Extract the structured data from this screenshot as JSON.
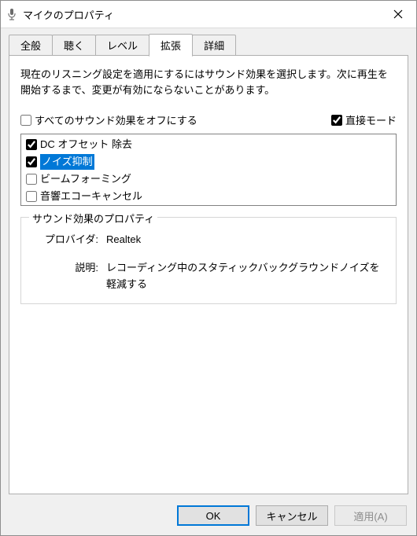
{
  "window": {
    "title": "マイクのプロパティ"
  },
  "tabs": {
    "general": "全般",
    "listen": "聴く",
    "levels": "レベル",
    "enhance": "拡張",
    "advanced": "詳細"
  },
  "intro": "現在のリスニング設定を適用にするにはサウンド効果を選択します。次に再生を開始するまで、変更が有効にならないことがあります。",
  "row_checks": {
    "disable_all": {
      "label": "すべてのサウンド効果をオフにする",
      "checked": false
    },
    "direct_mode": {
      "label": "直接モード",
      "checked": true
    }
  },
  "effects": [
    {
      "label": "DC オフセット 除去",
      "checked": true,
      "selected": false
    },
    {
      "label": "ノイズ抑制",
      "checked": true,
      "selected": true
    },
    {
      "label": "ビームフォーミング",
      "checked": false,
      "selected": false
    },
    {
      "label": "音響エコーキャンセル",
      "checked": false,
      "selected": false
    }
  ],
  "group": {
    "legend": "サウンド効果のプロパティ",
    "provider_k": "プロバイダ:",
    "provider_v": "Realtek",
    "desc_k": "説明:",
    "desc_v": "レコーディング中のスタティックバックグラウンドノイズを軽減する"
  },
  "buttons": {
    "ok": "OK",
    "cancel": "キャンセル",
    "apply": "適用(A)"
  }
}
